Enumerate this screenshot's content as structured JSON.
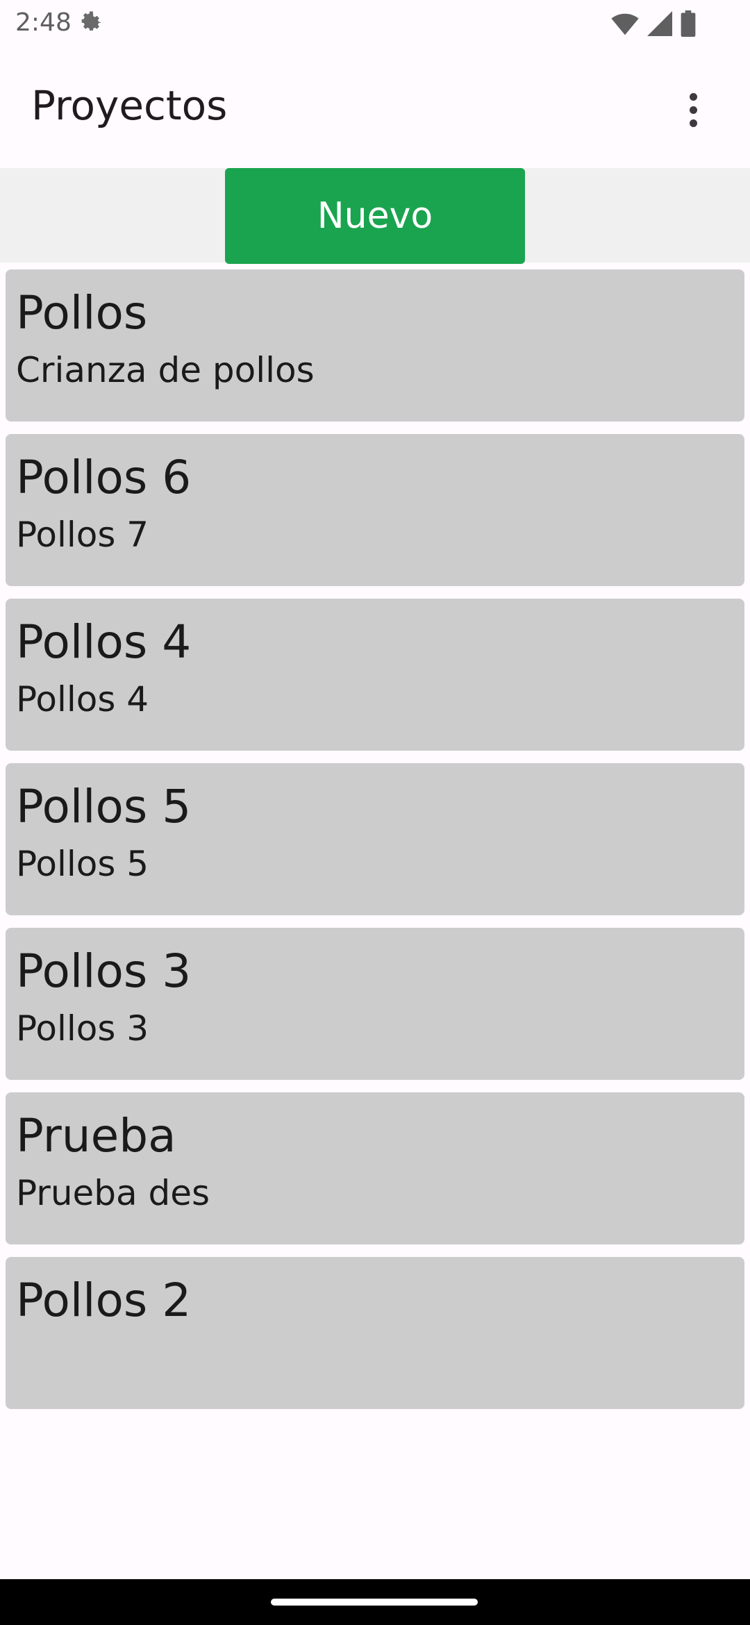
{
  "status_bar": {
    "time": "2:48",
    "icons": [
      "settings-gear-icon",
      "wifi-icon",
      "cell-signal-icon",
      "battery-icon"
    ]
  },
  "app_bar": {
    "title": "Proyectos",
    "menu_icon": "more-vert-icon"
  },
  "toolbar": {
    "new_label": "Nuevo",
    "accent_color": "#1aa44f"
  },
  "projects": [
    {
      "name": "Pollos",
      "description": "Crianza de pollos"
    },
    {
      "name": "Pollos 6",
      "description": "Pollos 7"
    },
    {
      "name": "Pollos 4",
      "description": "Pollos 4"
    },
    {
      "name": "Pollos 5",
      "description": "Pollos 5"
    },
    {
      "name": "Pollos 3",
      "description": "Pollos 3"
    },
    {
      "name": "Prueba",
      "description": "Prueba des"
    },
    {
      "name": "Pollos 2",
      "description": ""
    }
  ],
  "colors": {
    "card_background": "#cccccc",
    "strip_background": "#f0f0f0",
    "page_background": "#fffbfe"
  }
}
